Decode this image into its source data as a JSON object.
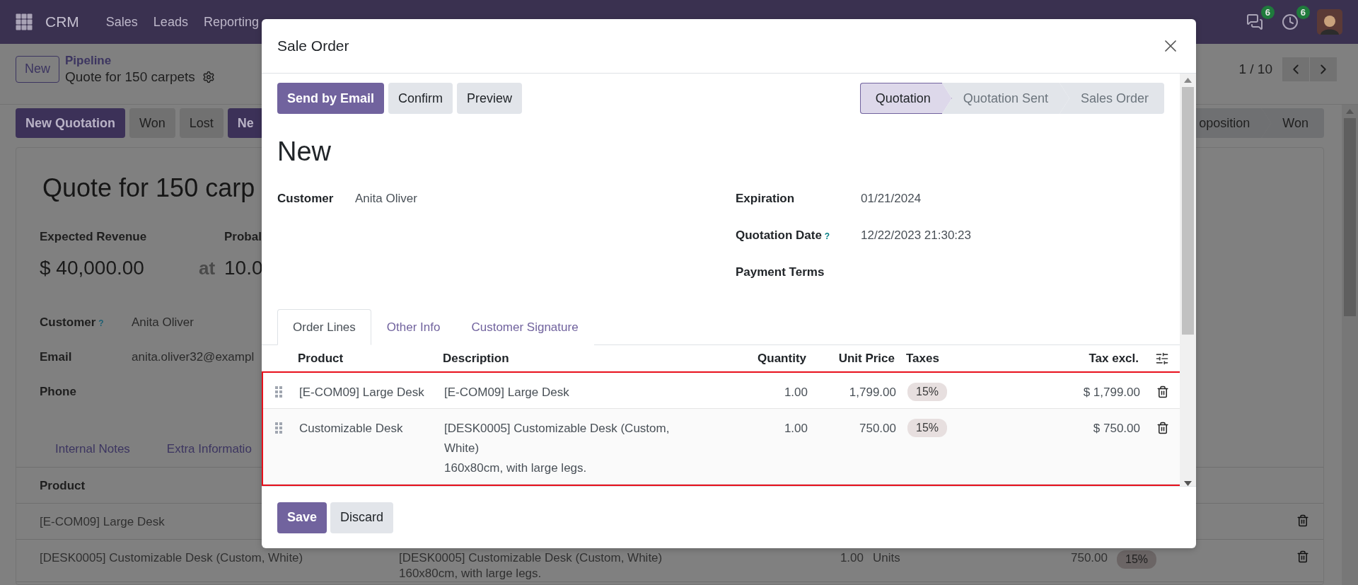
{
  "navbar": {
    "app": "CRM",
    "menu": [
      "Sales",
      "Leads",
      "Reporting"
    ],
    "messages_badge": "6",
    "activities_badge": "6"
  },
  "control_panel": {
    "new_button": "New",
    "breadcrumb": "Pipeline",
    "record": "Quote for 150 carpets",
    "pager": "1 / 10"
  },
  "status_buttons": [
    {
      "label": "New Quotation",
      "kind": "primary"
    },
    {
      "label": "Won",
      "kind": "secondary"
    },
    {
      "label": "Lost",
      "kind": "secondary"
    },
    {
      "label": "Ne",
      "kind": "primary"
    }
  ],
  "stages": [
    "oposition",
    "Won"
  ],
  "sheet": {
    "title": "Quote for 150 carp",
    "revenue_label": "Expected Revenue",
    "probability_label": "Probal",
    "revenue": "$ 40,000.00",
    "at": "at",
    "probability": "10.0",
    "fields": [
      {
        "label": "Customer",
        "help": "?",
        "value": "Anita Oliver"
      },
      {
        "label": "Email",
        "value": "anita.oliver32@exampl"
      },
      {
        "label": "Phone"
      }
    ],
    "tabs": [
      "Internal Notes",
      "Extra Informatio"
    ],
    "table": {
      "columns": [
        "Product"
      ],
      "rows": [
        {
          "product": "[E-COM09] Large Desk"
        },
        {
          "product": "[DESK0005] Customizable Desk (Custom, White)",
          "description": [
            "[DESK0005] Customizable Desk (Custom, White)",
            "160x80cm, with large legs."
          ],
          "quantity": "1.00",
          "uom": "Units",
          "price": "750.00",
          "tax": "15%"
        }
      ]
    }
  },
  "dialog": {
    "title": "Sale Order",
    "actions": [
      {
        "label": "Send by Email",
        "kind": "primary"
      },
      {
        "label": "Confirm",
        "kind": "secondary"
      },
      {
        "label": "Preview",
        "kind": "secondary"
      }
    ],
    "stages": [
      {
        "label": "Quotation",
        "selected": true
      },
      {
        "label": "Quotation Sent",
        "selected": false
      },
      {
        "label": "Sales Order",
        "selected": false
      }
    ],
    "name": "New",
    "customer": {
      "label": "Customer",
      "value": "Anita Oliver"
    },
    "right_fields": [
      {
        "label": "Expiration",
        "value": "01/21/2024"
      },
      {
        "label": "Quotation Date",
        "help": "?",
        "value": "12/22/2023 21:30:23"
      },
      {
        "label": "Payment Terms"
      }
    ],
    "tabs": [
      {
        "label": "Order Lines",
        "selected": true
      },
      {
        "label": "Other Info",
        "selected": false
      },
      {
        "label": "Customer Signature",
        "selected": false
      }
    ],
    "table": {
      "columns": [
        "Product",
        "Description",
        "Quantity",
        "Unit Price",
        "Taxes",
        "Tax excl."
      ],
      "rows": [
        {
          "product": "[E-COM09] Large Desk",
          "description": [
            "[E-COM09] Large Desk"
          ],
          "quantity": "1.00",
          "unit_price": "1,799.00",
          "tax": "15%",
          "subtotal": "$ 1,799.00"
        },
        {
          "product": "Customizable Desk",
          "description": [
            "[DESK0005] Customizable Desk (Custom,",
            "White)",
            "160x80cm, with large legs."
          ],
          "quantity": "1.00",
          "unit_price": "750.00",
          "tax": "15%",
          "subtotal": "$ 750.00"
        }
      ]
    },
    "footer": [
      {
        "label": "Save",
        "kind": "primary"
      },
      {
        "label": "Discard",
        "kind": "secondary"
      }
    ]
  }
}
